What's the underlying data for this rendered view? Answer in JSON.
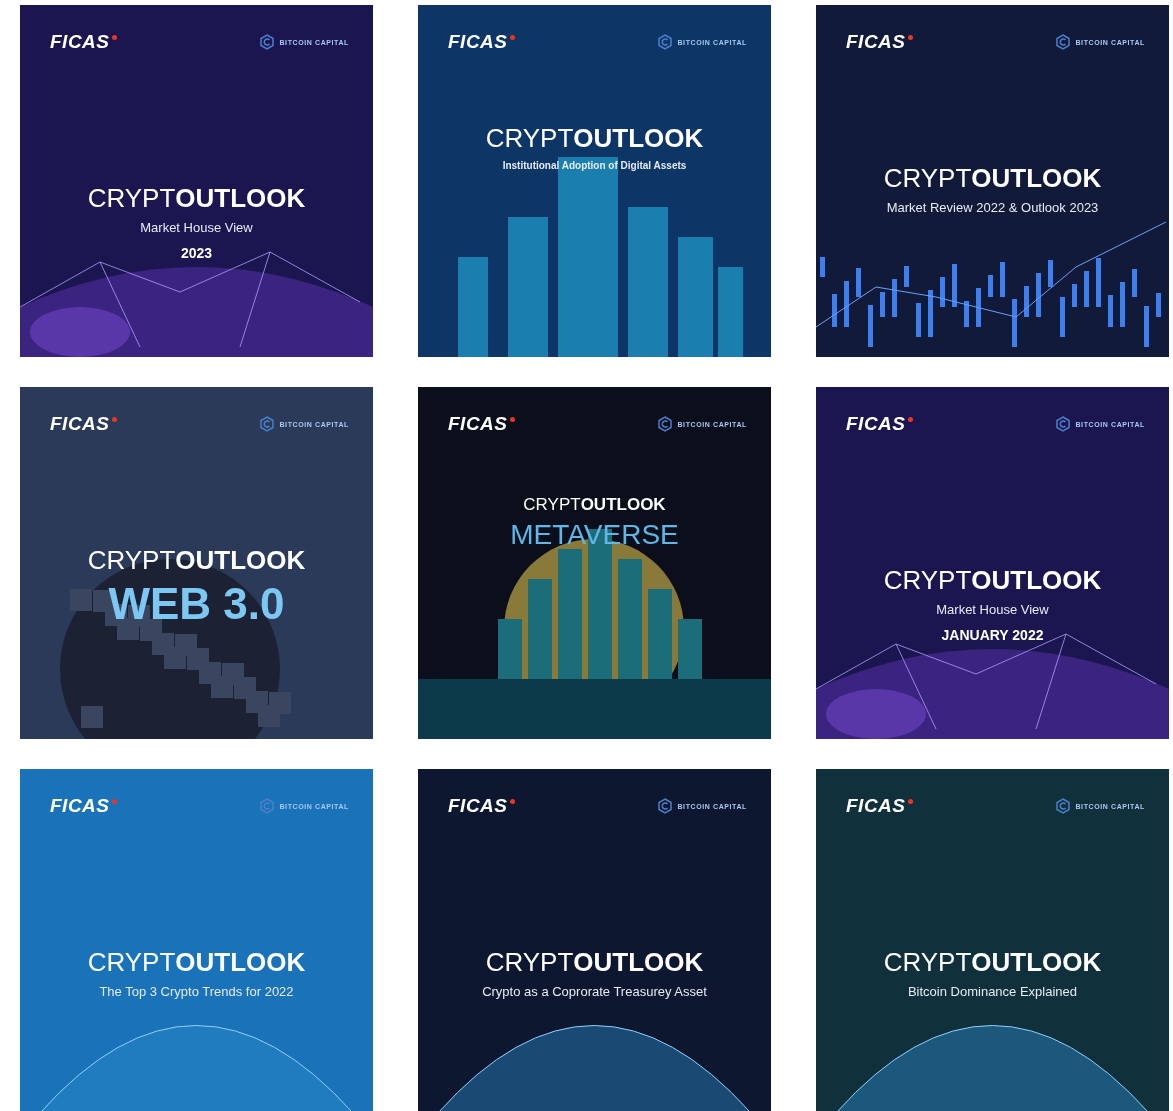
{
  "covers": [
    {
      "kind": "globe",
      "color": "#1c1650",
      "logo": "FICAS",
      "partner": "BITCOIN CAPITAL",
      "title": "CRYPT**OUTLOOK**",
      "subtitle": "Market House View",
      "year": "2023"
    },
    {
      "kind": "city",
      "color": "#0d3566",
      "logo": "FICAS",
      "partner": "BITCOIN CAPITAL",
      "title": "CRYPT**OUTLOOK**",
      "subtitle": "Institutional Adoption of Digital Assets"
    },
    {
      "kind": "chart",
      "color": "#111a38",
      "logo": "FICAS",
      "partner": "BITCOIN CAPITAL",
      "title": "CRYPT**OUTLOOK**",
      "subtitle": "Market Review 2022 & Outlook 2023"
    },
    {
      "kind": "cubes",
      "color": "#2b3a58",
      "logo": "FICAS",
      "partner": "BITCOIN CAPITAL",
      "title": "CRYPT**OUTLOOK**",
      "headline": "WEB 3.0"
    },
    {
      "kind": "metaverse",
      "color": "#0b0f1c",
      "logo": "FICAS",
      "partner": "BITCOIN CAPITAL",
      "title": "CRYPT**OUTLOOK**",
      "headline": "METAVERSE"
    },
    {
      "kind": "globe",
      "color": "#1c1650",
      "logo": "FICAS",
      "partner": "BITCOIN CAPITAL",
      "title": "CRYPT**OUTLOOK**",
      "subtitle": "Market House View",
      "year": "JANUARY 2022"
    },
    {
      "kind": "earth",
      "color": "#1a72b8",
      "logo": "FICAS",
      "partner": "BITCOIN CAPITAL",
      "title": "CRYPT**OUTLOOK**",
      "subtitle": "The Top 3 Crypto Trends for 2022"
    },
    {
      "kind": "earth",
      "color": "#0d1730",
      "logo": "FICAS",
      "partner": "BITCOIN CAPITAL",
      "title": "CRYPT**OUTLOOK**",
      "subtitle": "Crypto as a Coprorate Treasurey Asset"
    },
    {
      "kind": "earth",
      "color": "#10303c",
      "logo": "FICAS",
      "partner": "BITCOIN CAPITAL",
      "title": "CRYPT**OUTLOOK**",
      "subtitle": "Bitcoin Dominance Explained"
    }
  ]
}
